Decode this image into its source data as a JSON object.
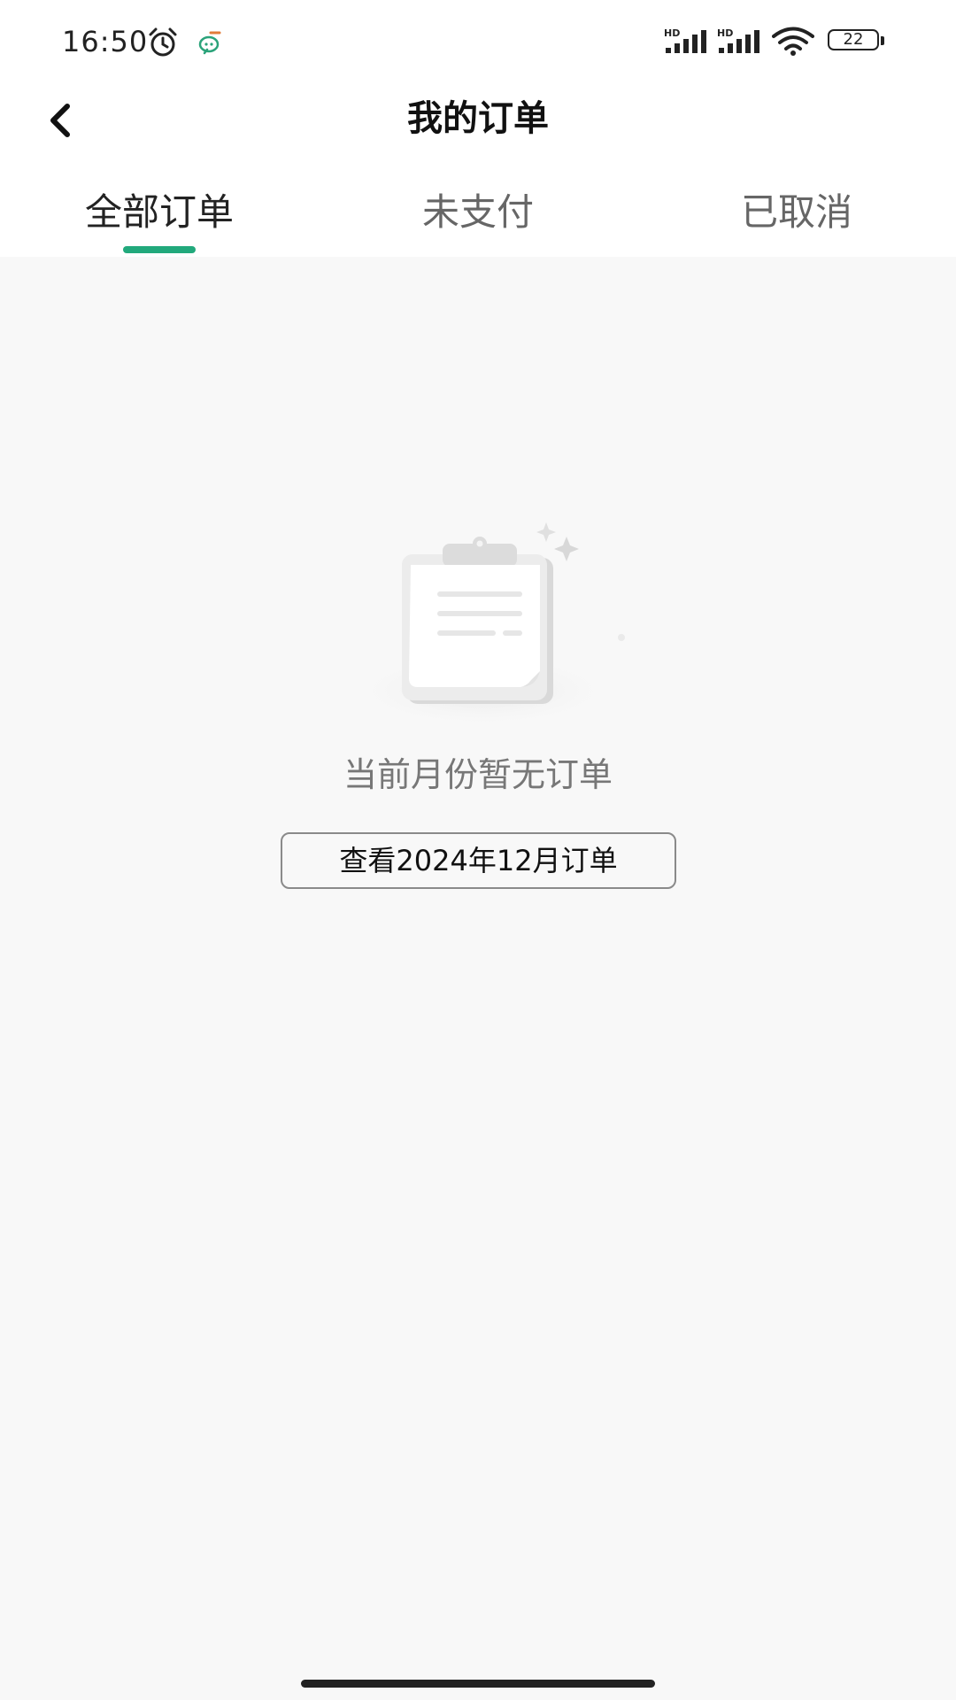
{
  "status_bar": {
    "time": "16:50",
    "battery": "22",
    "icons": [
      "alarm-icon",
      "app-notification-icon",
      "signal-hd-icon",
      "signal-hd-icon",
      "wifi-icon",
      "battery-icon"
    ]
  },
  "header": {
    "title": "我的订单",
    "back_icon": "chevron-left-icon"
  },
  "tabs": [
    {
      "label": "全部订单",
      "active": true
    },
    {
      "label": "未支付",
      "active": false
    },
    {
      "label": "已取消",
      "active": false
    }
  ],
  "empty_state": {
    "illustration": "clipboard-icon",
    "message": "当前月份暂无订单",
    "button_label": "查看2024年12月订单"
  },
  "colors": {
    "accent": "#22a97c",
    "background": "#f8f8f8",
    "header_background": "#ffffff"
  }
}
